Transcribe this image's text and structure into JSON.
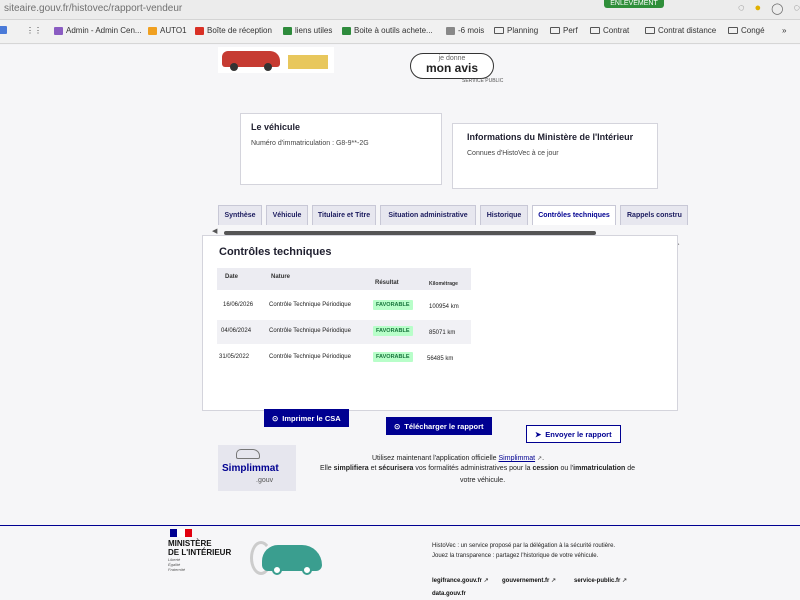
{
  "browser": {
    "url": "siteaire.gouv.fr/histovec/rapport-vendeur",
    "badge": "ENLEVEMENT"
  },
  "bookmarks": [
    {
      "label": "Admin - Admin Cen...",
      "color": "#8a5cc2"
    },
    {
      "label": "AUTO1",
      "color": "#f0a020"
    },
    {
      "label": "Boîte de réception",
      "color": "#d93025"
    },
    {
      "label": "liens utiles",
      "color": "#2e8b3c"
    },
    {
      "label": "Boite à outils achete...",
      "color": "#2e8b3c"
    },
    {
      "label": "-6 mois",
      "color": "#888888"
    },
    {
      "label": "Planning",
      "color": "folder"
    },
    {
      "label": "Perf",
      "color": "folder"
    },
    {
      "label": "Contrat",
      "color": "folder"
    },
    {
      "label": "Contrat distance",
      "color": "folder"
    },
    {
      "label": "Congé",
      "color": "folder"
    }
  ],
  "header": {
    "avis_small": "je donne",
    "avis_big": "mon avis",
    "avis_note": "SERVICE PUBLIC"
  },
  "vehicle_card": {
    "title": "Le véhicule",
    "plate_label": "Numéro d'immatriculation : G8-9**-2G"
  },
  "ministry_card": {
    "title": "Informations du Ministère de l'Intérieur",
    "subtitle": "Connues d'HistoVec à ce jour"
  },
  "tabs": [
    {
      "label": "Synthèse",
      "active": false
    },
    {
      "label": "Véhicule",
      "active": false
    },
    {
      "label": "Titulaire et Titre",
      "active": false
    },
    {
      "label": "Situation administrative",
      "active": false
    },
    {
      "label": "Historique",
      "active": false
    },
    {
      "label": "Contrôles techniques",
      "active": true
    },
    {
      "label": "Rappels constru",
      "active": false
    }
  ],
  "ct": {
    "title": "Contrôles techniques",
    "headers": {
      "date": "Date",
      "nature": "Nature",
      "result": "Résultat",
      "km": "Kilométrage"
    },
    "rows": [
      {
        "date": "16/06/2026",
        "nature": "Contrôle Technique Périodique",
        "result": "FAVORABLE",
        "km": "100954 km"
      },
      {
        "date": "04/06/2024",
        "nature": "Contrôle Technique Périodique",
        "result": "FAVORABLE",
        "km": "85071 km"
      },
      {
        "date": "31/05/2022",
        "nature": "Contrôle Technique Périodique",
        "result": "FAVORABLE",
        "km": "56485 km"
      }
    ]
  },
  "actions": {
    "print": "Imprimer le CSA",
    "download": "Télécharger le rapport",
    "send": "Envoyer le rapport"
  },
  "promo": {
    "logo_title": "Simplimmat",
    "logo_sub": ".gouv",
    "line1_pre": "Utilisez maintenant l'application officielle",
    "line1_link": "Simplimmat",
    "line2_a": "Elle",
    "line2_b": "simplifiera",
    "line2_c": "et",
    "line2_d": "sécurisera",
    "line2_e": "vos formalités administratives pour la",
    "line2_f": "cession",
    "line2_g": "ou l'",
    "line2_h": "immatriculation",
    "line2_i": "de",
    "line3": "votre véhicule."
  },
  "footer": {
    "ministry_line1": "MINISTÈRE",
    "ministry_line2": "DE L'INTÉRIEUR",
    "motto": [
      "Liberté",
      "Égalité",
      "Fraternité"
    ],
    "desc1": "HistoVec : un service proposé par la délégation à la sécurité routière.",
    "desc2": "Jouez la transparence : partagez l'historique de votre véhicule.",
    "links": [
      "legifrance.gouv.fr",
      "gouvernement.fr",
      "service-public.fr"
    ],
    "link_bottom": "data.gouv.fr"
  }
}
